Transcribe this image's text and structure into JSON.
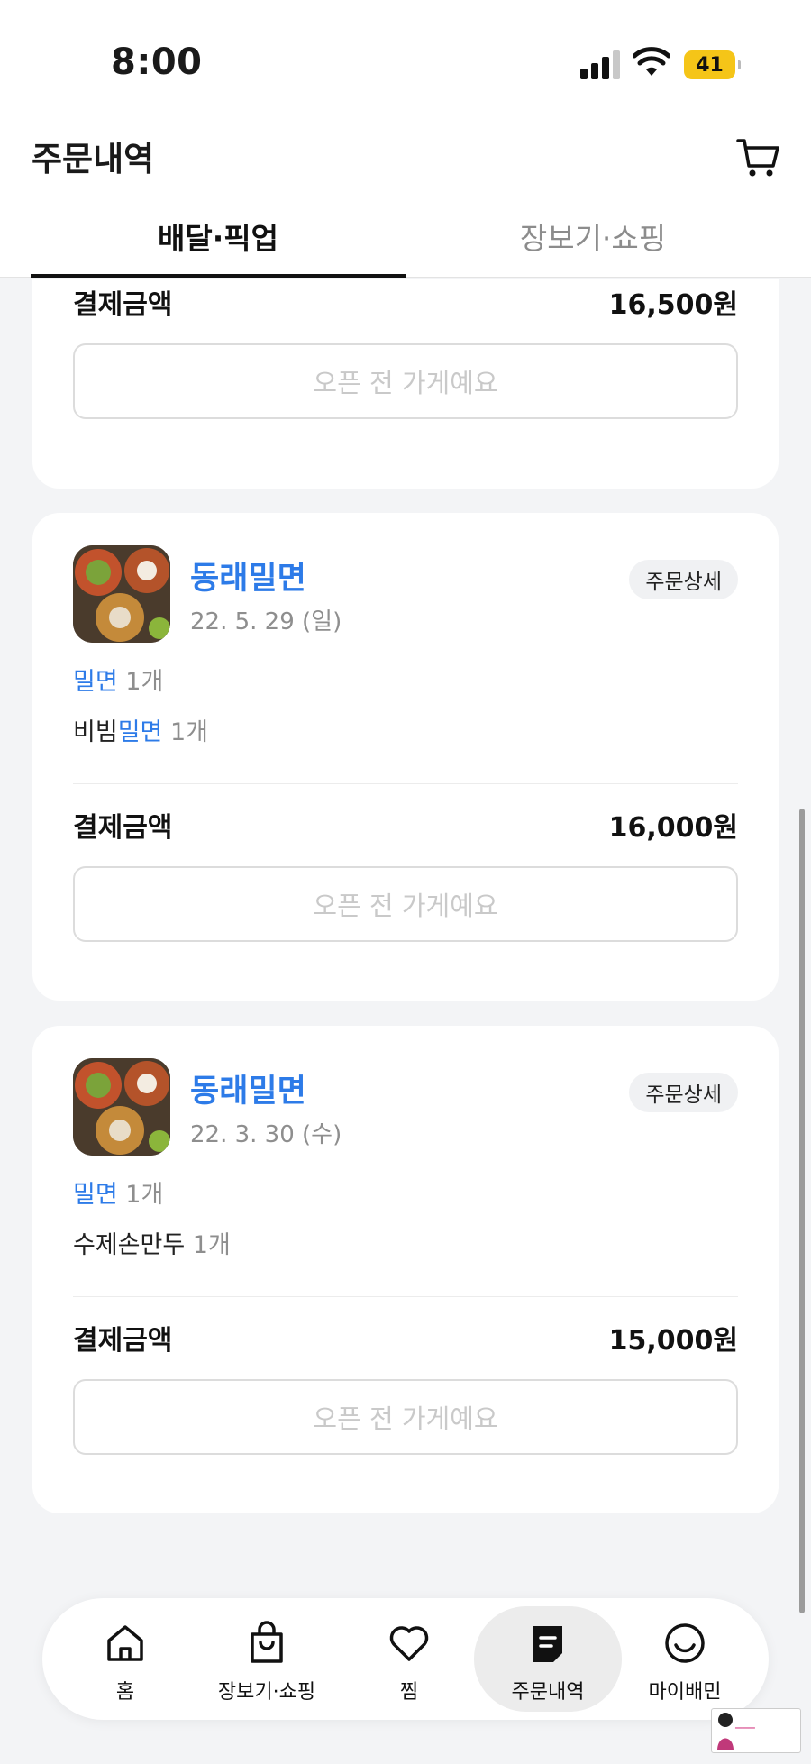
{
  "status_bar": {
    "time": "8:00",
    "battery": "41"
  },
  "header": {
    "title": "주문내역"
  },
  "tabs": [
    {
      "label": "배달·픽업",
      "active": true
    },
    {
      "label": "장보기·쇼핑",
      "active": false
    }
  ],
  "orders": [
    {
      "payment_label": "결제금액",
      "payment_amount": "16,500원",
      "status_button": "오픈 전 가게예요"
    },
    {
      "store_name": "동래밀면",
      "date": "22. 5. 29 (일)",
      "detail_button": "주문상세",
      "items": [
        {
          "prefix": "",
          "highlight": "밀면",
          "qty": " 1개"
        },
        {
          "prefix": "비빔",
          "highlight": "밀면",
          "qty": " 1개"
        }
      ],
      "payment_label": "결제금액",
      "payment_amount": "16,000원",
      "status_button": "오픈 전 가게예요"
    },
    {
      "store_name": "동래밀면",
      "date": "22. 3. 30 (수)",
      "detail_button": "주문상세",
      "items": [
        {
          "prefix": "",
          "highlight": "밀면",
          "qty": " 1개"
        },
        {
          "prefix": "수제손만두",
          "highlight": "",
          "qty": " 1개"
        }
      ],
      "payment_label": "결제금액",
      "payment_amount": "15,000원",
      "status_button": "오픈 전 가게예요"
    }
  ],
  "bottom_nav": [
    {
      "label": "홈",
      "icon": "home-icon"
    },
    {
      "label": "장보기·쇼핑",
      "icon": "shopping-bag-icon"
    },
    {
      "label": "찜",
      "icon": "heart-icon"
    },
    {
      "label": "주문내역",
      "icon": "receipt-icon",
      "active": true
    },
    {
      "label": "마이배민",
      "icon": "smile-icon"
    }
  ],
  "colors": {
    "accent": "#2d7be8",
    "background": "#f3f4f6"
  }
}
